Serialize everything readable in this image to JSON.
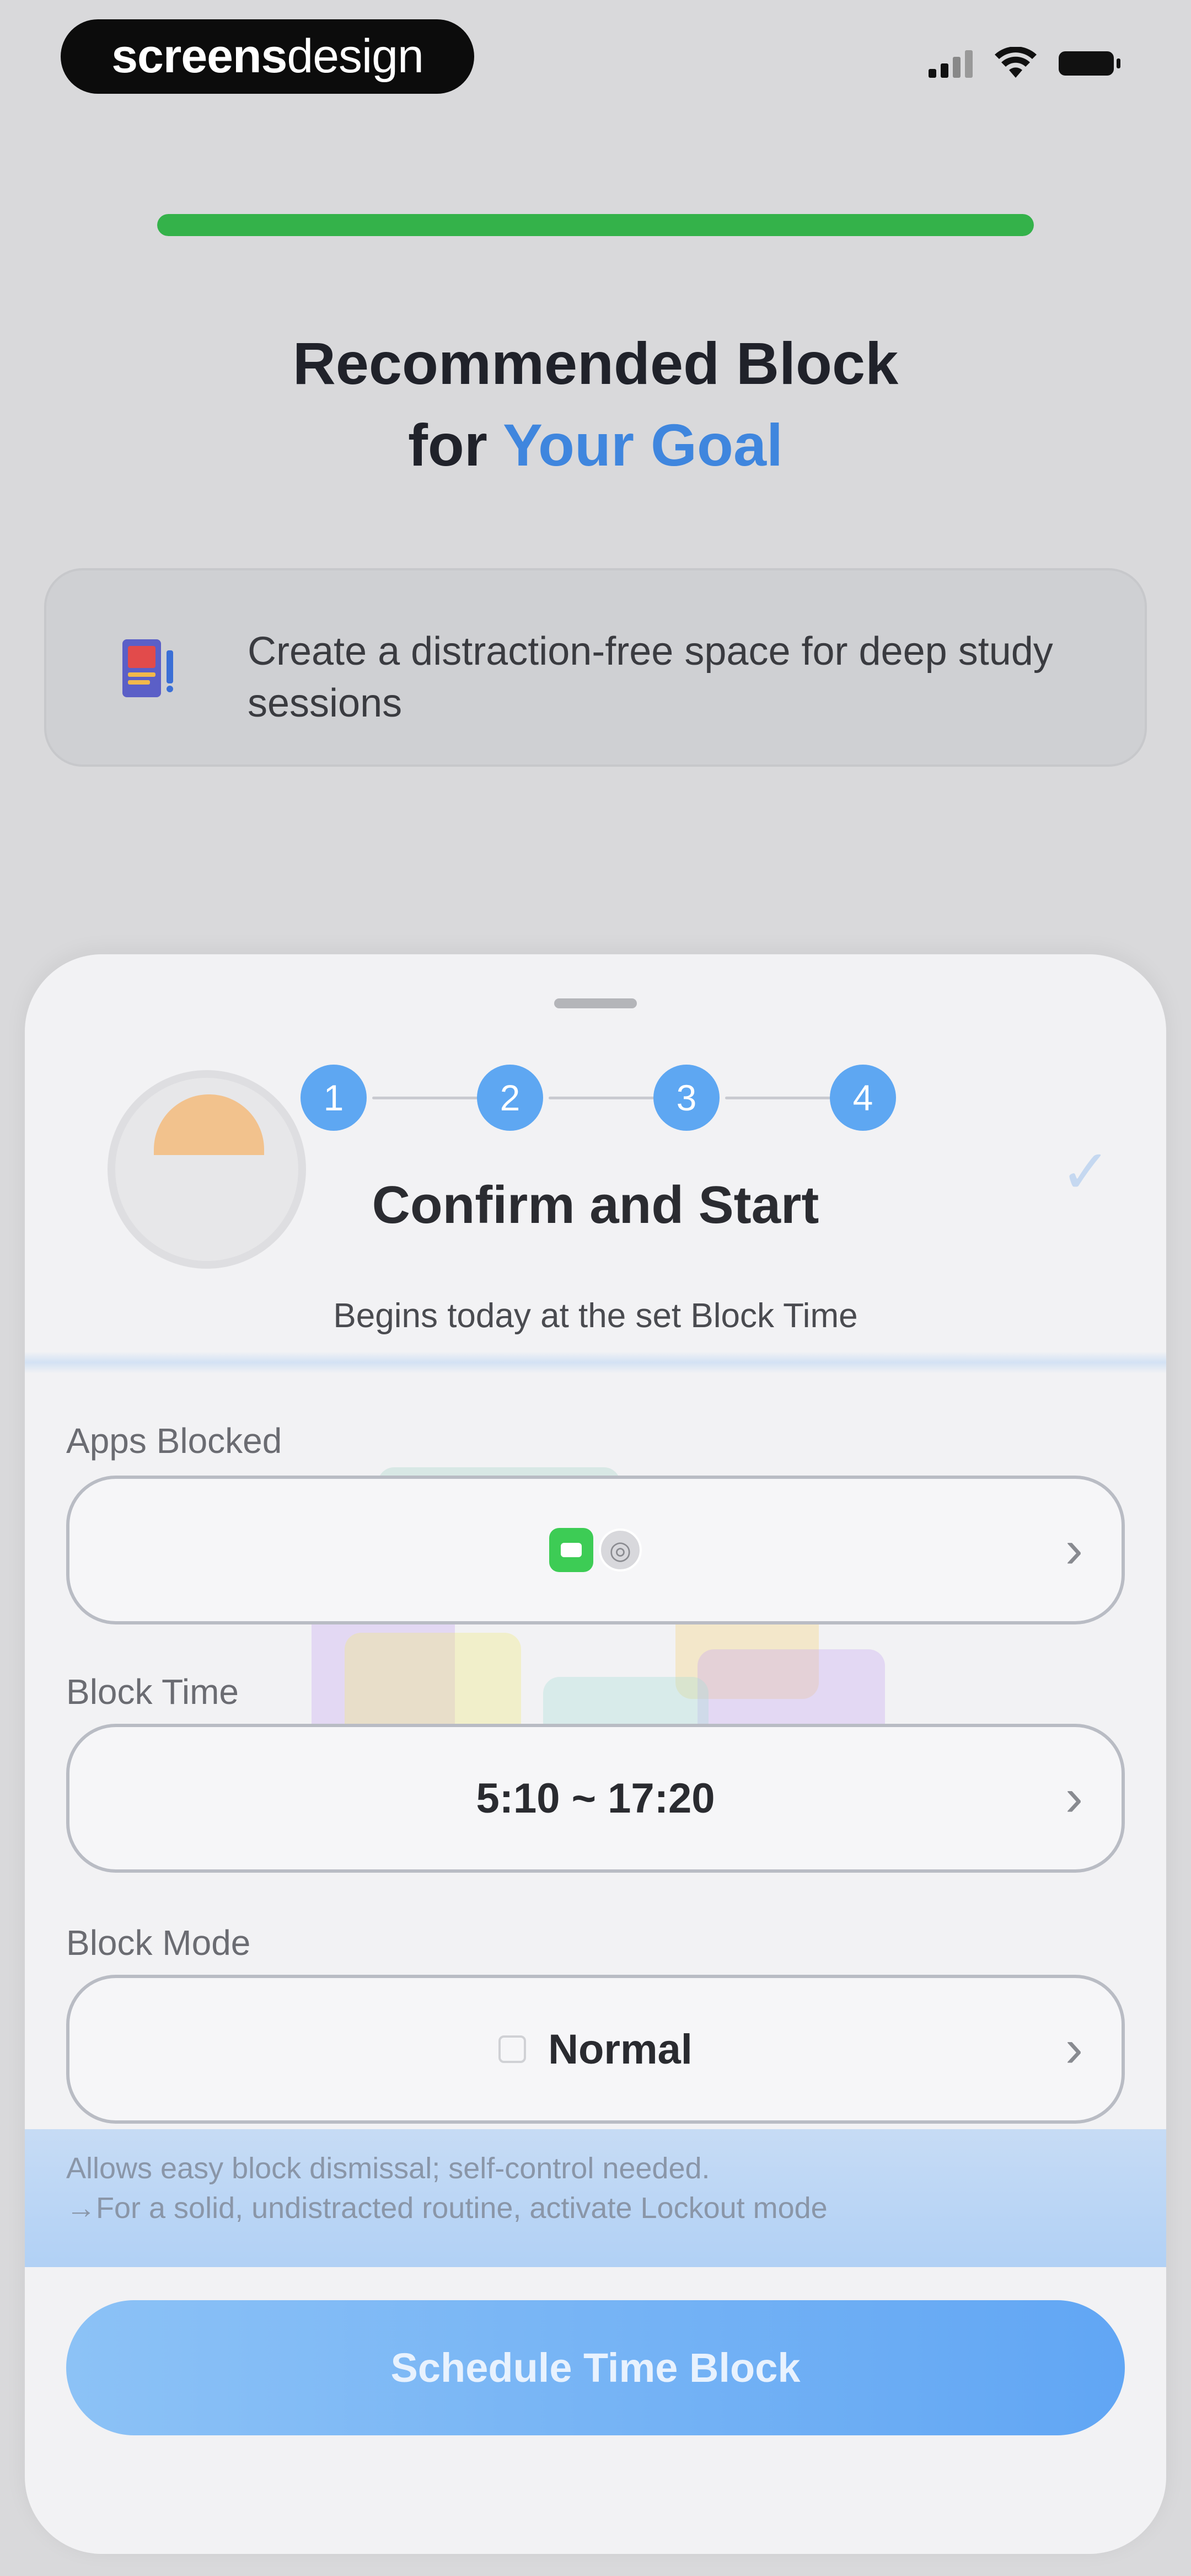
{
  "status_bar": {
    "brand_bold": "screens",
    "brand_light": "design"
  },
  "onboarding": {
    "progress": 1.0,
    "title_line1": "Recommended Block",
    "title_line2_prefix": "for ",
    "title_line2_accent": "Your Goal",
    "goal_text": "Create a distraction-free space for deep study sessions",
    "goal_icon": "notebook-icon"
  },
  "sheet": {
    "steps": [
      "1",
      "2",
      "3",
      "4"
    ],
    "title": "Confirm and Start",
    "subtitle": "Begins today at the set Block Time",
    "apps_blocked": {
      "label": "Apps Blocked",
      "icons": [
        "facetime-icon",
        "app-icon"
      ]
    },
    "block_time": {
      "label": "Block Time",
      "value": "5:10 ~ 17:20"
    },
    "block_mode": {
      "label": "Block Mode",
      "value": "Normal"
    },
    "note_line1": "Allows easy block dismissal; self-control needed.",
    "note_line2": "→For a solid, undistracted routine, activate Lockout mode",
    "cta_label": "Schedule Time Block"
  },
  "colors": {
    "accent": "#3f86de",
    "progress": "#34b24a",
    "cta": "#61a6f4",
    "step": "#5ea7f2"
  }
}
